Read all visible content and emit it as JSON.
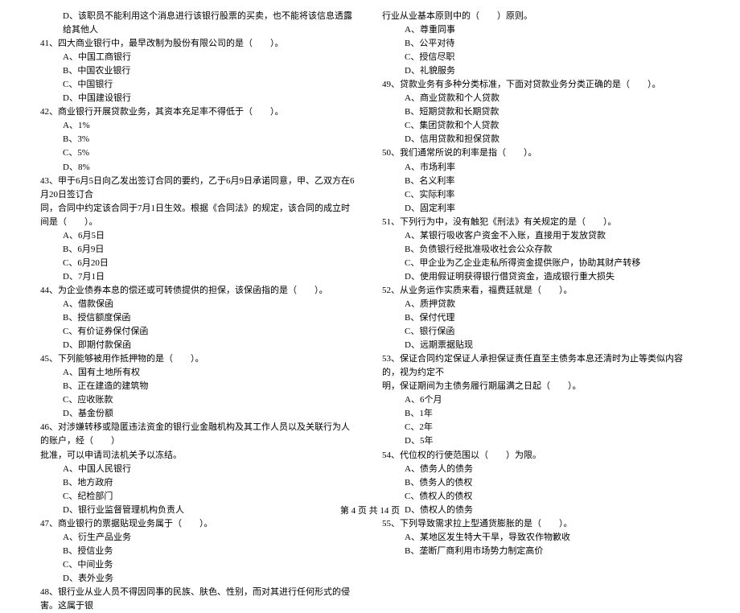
{
  "footer": "第 4 页 共 14 页",
  "col1": [
    {
      "cls": "opt",
      "t": "D、该职员不能利用这个消息进行该银行股票的买卖，也不能将该信息透露给其他人"
    },
    {
      "cls": "stem",
      "t": "41、四大商业银行中，最早改制为股份有限公司的是（　　）。"
    },
    {
      "cls": "opt",
      "t": "A、中国工商银行"
    },
    {
      "cls": "opt",
      "t": "B、中国农业银行"
    },
    {
      "cls": "opt",
      "t": "C、中国银行"
    },
    {
      "cls": "opt",
      "t": "D、中国建设银行"
    },
    {
      "cls": "stem",
      "t": "42、商业银行开展贷款业务，其资本充足率不得低于（　　）。"
    },
    {
      "cls": "opt",
      "t": "A、1%"
    },
    {
      "cls": "opt",
      "t": "B、3%"
    },
    {
      "cls": "opt",
      "t": "C、5%"
    },
    {
      "cls": "opt",
      "t": "D、8%"
    },
    {
      "cls": "stem",
      "t": "43、甲于6月5日向乙发出签订合同的要约，乙于6月9日承诺同意，甲、乙双方在6月20日签订合"
    },
    {
      "cls": "stem-cont",
      "t": "同，合同中约定该合同于7月1日生效。根据《合同法》的规定，该合同的成立时间是（　　）。"
    },
    {
      "cls": "opt",
      "t": "A、6月5日"
    },
    {
      "cls": "opt",
      "t": "B、6月9日"
    },
    {
      "cls": "opt",
      "t": "C、6月20日"
    },
    {
      "cls": "opt",
      "t": "D、7月1日"
    },
    {
      "cls": "stem",
      "t": "44、为企业债券本息的偿还或可转债提供的担保，该保函指的是（　　）。"
    },
    {
      "cls": "opt",
      "t": "A、借款保函"
    },
    {
      "cls": "opt",
      "t": "B、授信额度保函"
    },
    {
      "cls": "opt",
      "t": "C、有价证券保付保函"
    },
    {
      "cls": "opt",
      "t": "D、即期付款保函"
    },
    {
      "cls": "stem",
      "t": "45、下列能够被用作抵押物的是（　　）。"
    },
    {
      "cls": "opt",
      "t": "A、国有土地所有权"
    },
    {
      "cls": "opt",
      "t": "B、正在建造的建筑物"
    },
    {
      "cls": "opt",
      "t": "C、应收账款"
    },
    {
      "cls": "opt",
      "t": "D、基金份额"
    },
    {
      "cls": "stem",
      "t": "46、对涉嫌转移或隐匿违法资金的银行业金融机构及其工作人员以及关联行为人的账户，经（　　）"
    },
    {
      "cls": "stem-cont",
      "t": "批准，可以申请司法机关予以冻结。"
    },
    {
      "cls": "opt",
      "t": "A、中国人民银行"
    },
    {
      "cls": "opt",
      "t": "B、地方政府"
    },
    {
      "cls": "opt",
      "t": "C、纪检部门"
    },
    {
      "cls": "opt",
      "t": "D、银行业监督管理机构负责人"
    },
    {
      "cls": "stem",
      "t": "47、商业银行的票据贴现业务属于（　　）。"
    },
    {
      "cls": "opt",
      "t": "A、衍生产品业务"
    },
    {
      "cls": "opt",
      "t": "B、授信业务"
    },
    {
      "cls": "opt",
      "t": "C、中间业务"
    },
    {
      "cls": "opt",
      "t": "D、表外业务"
    },
    {
      "cls": "stem",
      "t": "48、银行业从业人员不得因同事的民族、肤色、性别，而对其进行任何形式的侵害。这属于银"
    }
  ],
  "col2": [
    {
      "cls": "stem-cont",
      "t": "行业从业基本原则中的（　　）原则。"
    },
    {
      "cls": "opt",
      "t": "A、尊重同事"
    },
    {
      "cls": "opt",
      "t": "B、公平对待"
    },
    {
      "cls": "opt",
      "t": "C、授信尽职"
    },
    {
      "cls": "opt",
      "t": "D、礼貌服务"
    },
    {
      "cls": "stem",
      "t": "49、贷款业务有多种分类标准，下面对贷款业务分类正确的是（　　）。"
    },
    {
      "cls": "opt",
      "t": "A、商业贷款和个人贷款"
    },
    {
      "cls": "opt",
      "t": "B、短期贷款和长期贷款"
    },
    {
      "cls": "opt",
      "t": "C、集团贷款和个人贷款"
    },
    {
      "cls": "opt",
      "t": "D、信用贷款和担保贷款"
    },
    {
      "cls": "stem",
      "t": "50、我们通常所说的利率是指（　　）。"
    },
    {
      "cls": "opt",
      "t": "A、市场利率"
    },
    {
      "cls": "opt",
      "t": "B、名义利率"
    },
    {
      "cls": "opt",
      "t": "C、实际利率"
    },
    {
      "cls": "opt",
      "t": "D、固定利率"
    },
    {
      "cls": "stem",
      "t": "51、下列行为中，没有触犯《刑法》有关规定的是（　　）。"
    },
    {
      "cls": "opt",
      "t": "A、某银行吸收客户资金不入账，直接用于发放贷款"
    },
    {
      "cls": "opt",
      "t": "B、负债银行经批准吸收社会公众存款"
    },
    {
      "cls": "opt",
      "t": "C、甲企业为乙企业走私所得资金提供账户，协助其财产转移"
    },
    {
      "cls": "opt",
      "t": "D、使用假证明获得银行借贷资金，造成银行重大损失"
    },
    {
      "cls": "stem",
      "t": "52、从业务运作实质来看，福费廷就是（　　）。"
    },
    {
      "cls": "opt",
      "t": "A、质押贷款"
    },
    {
      "cls": "opt",
      "t": "B、保付代理"
    },
    {
      "cls": "opt",
      "t": "C、银行保函"
    },
    {
      "cls": "opt",
      "t": "D、远期票据贴现"
    },
    {
      "cls": "stem",
      "t": "53、保证合同约定保证人承担保证责任直至主债务本息还清时为止等类似内容的，视为约定不"
    },
    {
      "cls": "stem-cont",
      "t": "明，保证期间为主债务履行期届满之日起（　　）。"
    },
    {
      "cls": "opt",
      "t": "A、6个月"
    },
    {
      "cls": "opt",
      "t": "B、1年"
    },
    {
      "cls": "opt",
      "t": "C、2年"
    },
    {
      "cls": "opt",
      "t": "D、5年"
    },
    {
      "cls": "stem",
      "t": "54、代位权的行使范围以（　　）为限。"
    },
    {
      "cls": "opt",
      "t": "A、债务人的债务"
    },
    {
      "cls": "opt",
      "t": "B、债务人的债权"
    },
    {
      "cls": "opt",
      "t": "C、债权人的债权"
    },
    {
      "cls": "opt",
      "t": "D、债权人的债务"
    },
    {
      "cls": "stem",
      "t": "55、下列导致需求拉上型通货膨胀的是（　　）。"
    },
    {
      "cls": "opt",
      "t": "A、某地区发生特大干旱，导致农作物歉收"
    },
    {
      "cls": "opt",
      "t": "B、垄断厂商利用市场势力制定高价"
    }
  ]
}
